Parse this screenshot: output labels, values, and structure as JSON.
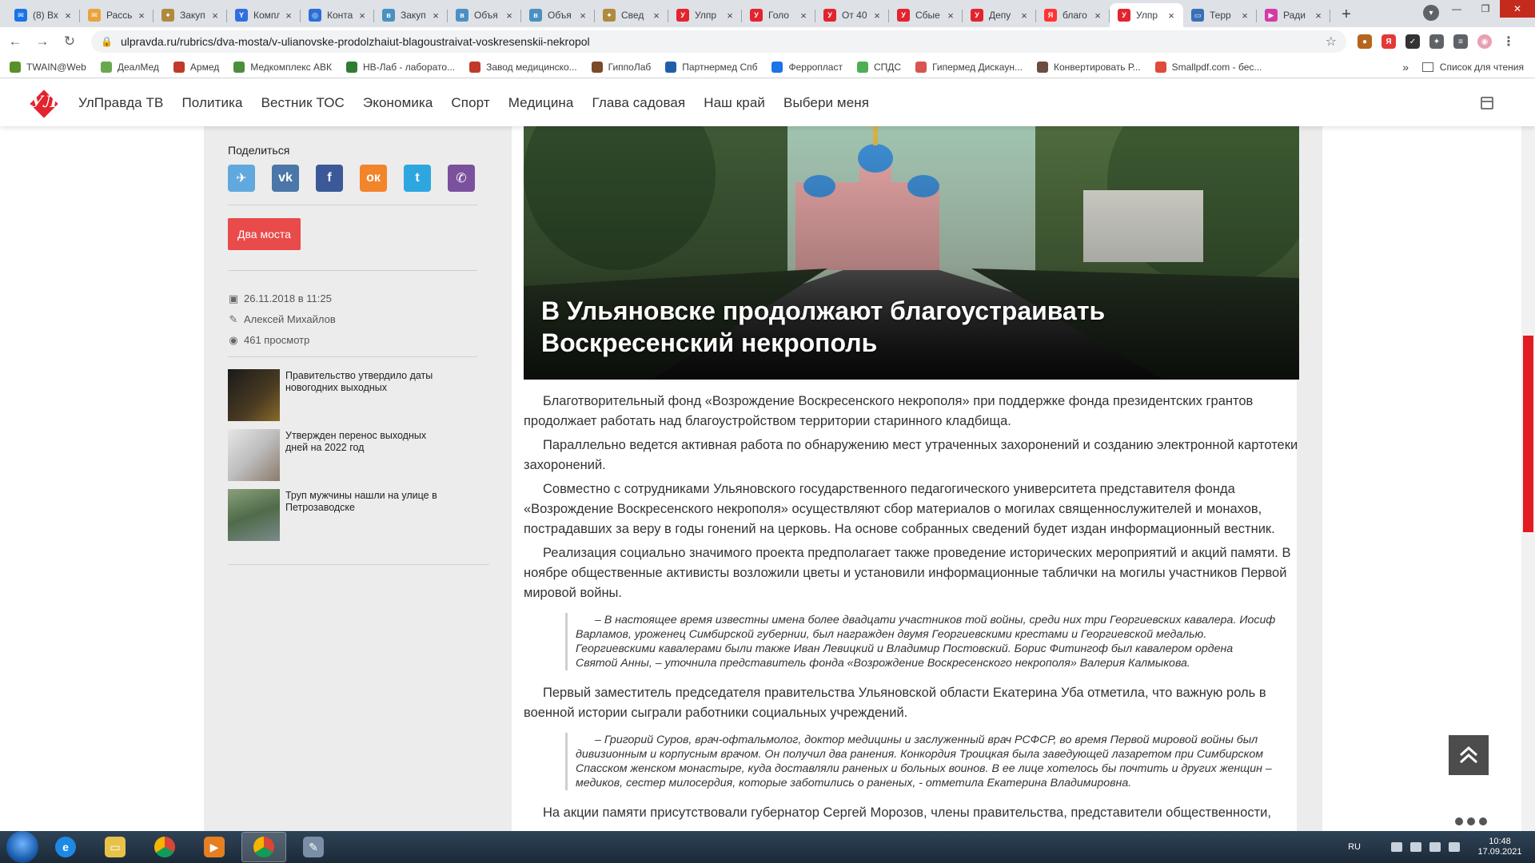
{
  "browser": {
    "tabs": [
      {
        "label": "(8) Вх",
        "color": "#1a73e8",
        "glyph": "✉"
      },
      {
        "label": "Рассы",
        "color": "#e8a33c",
        "glyph": "✉"
      },
      {
        "label": "Закуп",
        "color": "#b08a3c",
        "glyph": "✦"
      },
      {
        "label": "Компл",
        "color": "#2f6fe0",
        "glyph": "Y"
      },
      {
        "label": "Конта",
        "color": "#2a6fd6",
        "glyph": "◎"
      },
      {
        "label": "Закуп",
        "color": "#4a90c2",
        "glyph": "в"
      },
      {
        "label": "Объя",
        "color": "#4a90c2",
        "glyph": "в"
      },
      {
        "label": "Объя",
        "color": "#4a90c2",
        "glyph": "в"
      },
      {
        "label": "Свед",
        "color": "#b08a3c",
        "glyph": "✦"
      },
      {
        "label": "Улпр",
        "color": "#e3232e",
        "glyph": "У"
      },
      {
        "label": "Голо",
        "color": "#e3232e",
        "glyph": "У"
      },
      {
        "label": "От 40",
        "color": "#e3232e",
        "glyph": "У"
      },
      {
        "label": "Сбые",
        "color": "#e3232e",
        "glyph": "У"
      },
      {
        "label": "Депу",
        "color": "#e3232e",
        "glyph": "У"
      },
      {
        "label": "благо",
        "color": "#f33",
        "glyph": "Я"
      },
      {
        "label": "Улпр",
        "color": "#e3232e",
        "glyph": "У",
        "active": true
      },
      {
        "label": "Терр",
        "color": "#3a6fb8",
        "glyph": "▭"
      },
      {
        "label": "Ради",
        "color": "#d63aa6",
        "glyph": "▶"
      }
    ],
    "tab_close_glyph": "×",
    "new_tab_glyph": "+",
    "url": "ulpravda.ru/rubrics/dva-mosta/v-ulianovske-prodolzhaiut-blagoustraivat-voskresenskii-nekropol",
    "bookmarks": [
      {
        "label": "TWAIN@Web",
        "color": "#5a8f2a"
      },
      {
        "label": "ДеалМед",
        "color": "#6aa84f"
      },
      {
        "label": "Армед",
        "color": "#c0392b"
      },
      {
        "label": "Медкомплекс АВК",
        "color": "#4b8f3a"
      },
      {
        "label": "НВ-Лаб - лаборато...",
        "color": "#2e7d32"
      },
      {
        "label": "Завод медицинско...",
        "color": "#c0392b"
      },
      {
        "label": "ГиппоЛаб",
        "color": "#7b4a2a"
      },
      {
        "label": "Партнермед Спб",
        "color": "#1f5fa8"
      },
      {
        "label": "Ферропласт",
        "color": "#1a73e8"
      },
      {
        "label": "СПДС",
        "color": "#4caf50"
      },
      {
        "label": "Гипермед Дискаун...",
        "color": "#d9534f"
      },
      {
        "label": "Конвертировать Р...",
        "color": "#6d4c41"
      },
      {
        "label": "Smallpdf.com - бес...",
        "color": "#e04a3a"
      }
    ],
    "bookmarks_more": "»",
    "reading_list": "Список для чтения"
  },
  "site": {
    "logo_text": "УЛ",
    "nav": [
      "УлПравда ТВ",
      "Политика",
      "Вестник ТОС",
      "Экономика",
      "Спорт",
      "Медицина",
      "Глава садовая",
      "Наш край",
      "Выбери меня"
    ]
  },
  "sidebar": {
    "share_title": "Поделиться",
    "social": [
      {
        "name": "telegram",
        "color": "#61a8de",
        "glyph": "✈"
      },
      {
        "name": "vk",
        "color": "#4a76a8",
        "glyph": "vk"
      },
      {
        "name": "facebook",
        "color": "#3b5998",
        "glyph": "f"
      },
      {
        "name": "odnoklassniki",
        "color": "#f2842a",
        "glyph": "ок"
      },
      {
        "name": "twitter",
        "color": "#2ea7e0",
        "glyph": "t"
      },
      {
        "name": "viber",
        "color": "#7b519d",
        "glyph": "✆"
      }
    ],
    "tag": "Два моста",
    "date": "26.11.2018 в 11:25",
    "author": "Алексей Михайлов",
    "views": "461 просмотр",
    "related": [
      {
        "title": "Правительство утвердило даты новогодних выходных"
      },
      {
        "title": "Утвержден перенос выходных дней на 2022 год"
      },
      {
        "title": "Труп мужчины нашли на улице в Петрозаводске"
      }
    ]
  },
  "article": {
    "title": "В Ульяновске продолжают благоустраивать Воскресенский некрополь",
    "paragraphs": [
      "Благотворительный фонд «Возрождение Воскресенского некрополя» при поддержке фонда президентских грантов продолжает работать над благоустройством территории старинного кладбища.",
      "Параллельно ведется активная работа по обнаружению мест утраченных захоронений и созданию электронной картотеки захоронений.",
      "Совместно с сотрудниками Ульяновского государственного педагогического университета представителя фонда «Возрождение Воскресенского некрополя» осуществляют сбор материалов о могилах священнослужителей и монахов, пострадавших за веру в годы гонений на церковь. На основе собранных сведений будет издан информационный вестник.",
      "Реализация социально значимого проекта предполагает также проведение исторических мероприятий и акций памяти. В ноябре общественные активисты возложили цветы и установили информационные таблички на могилы участников Первой мировой войны."
    ],
    "quote1": "– В настоящее время известны имена более двадцати участников той войны, среди них три Георгиевских кавалера. Иосиф Варламов, уроженец Симбирской губернии, был награжден двумя Георгиевскими крестами и Георгиевской медалью. Георгиевскими кавалерами были также Иван Левицкий и Владимир Постовский. Борис Фитингоф был кавалером ордена Святой Анны, – уточнила представитель фонда «Возрождение Воскресенского некрополя» Валерия Калмыкова.",
    "paragraph5": "Первый заместитель председателя правительства Ульяновской области Екатерина Уба отметила, что важную роль в военной истории сыграли работники социальных учреждений.",
    "quote2": "– Григорий Суров, врач-офтальмолог, доктор медицины и заслуженный врач РСФСР, во время Первой мировой войны был дивизионным и корпусным врачом. Он получил два ранения. Конкордия Троицкая была заведующей лазаретом при Симбирском Спасском женском монастыре, куда доставляли раненых и больных воинов. В ее лице хотелось бы почтить и других женщин – медиков, сестер милосердия, которые заботились о раненых, - отметила Екатерина Владимировна.",
    "paragraph6": "На акции памяти присутствовали губернатор Сергей Морозов, члены правительства, представители общественности,"
  },
  "taskbar": {
    "lang": "RU",
    "time": "10:48",
    "date": "17.09.2021"
  }
}
